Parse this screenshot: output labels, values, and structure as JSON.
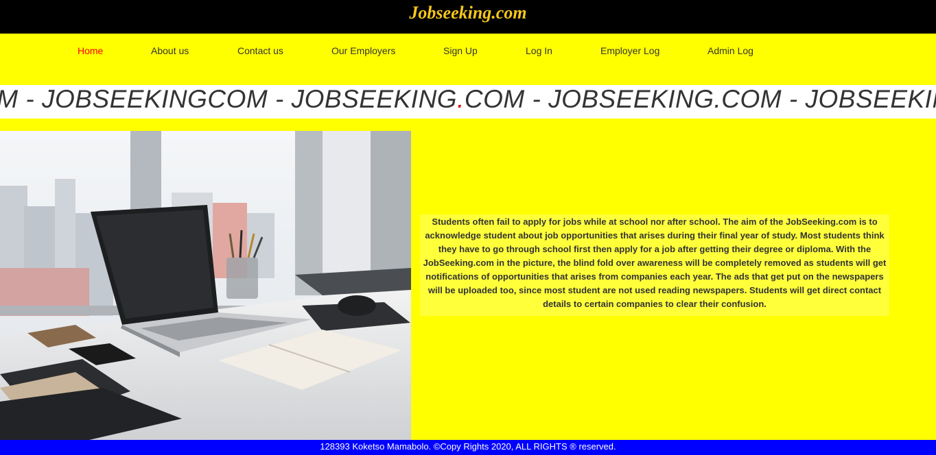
{
  "header": {
    "brand": "Jobseeking.com"
  },
  "nav": {
    "items": [
      {
        "label": "Home",
        "active": true
      },
      {
        "label": "About us"
      },
      {
        "label": "Contact us"
      },
      {
        "label": "Our Employers"
      },
      {
        "label": "Sign Up"
      },
      {
        "label": "Log In"
      },
      {
        "label": "Employer Log"
      },
      {
        "label": "Admin Log"
      }
    ]
  },
  "marquee": {
    "segments": [
      "OM - JOBSEEKINGCOM - JOBSEEKING",
      ".",
      "COM - JOBSEEKING.COM - JOBSEEKING",
      "."
    ]
  },
  "hero": {
    "image": "office-desk-laptop-photo"
  },
  "about": {
    "text": "Students often fail to apply for jobs while at school nor after school. The aim of the JobSeeking.com is to acknowledge student about job opportunities that arises during their final year of study. Most students think they have to go through school first then apply for a job after getting their degree or diploma. With the JobSeeking.com in the picture, the blind fold over awareness will be completely removed as students will get notifications of opportunities that arises from companies each year. The ads that get put on the newspapers will be uploaded too, since most student are not used reading newspapers. Students will get direct contact details to certain companies to clear their confusion."
  },
  "footer": {
    "text": "128393 Koketso Mamabolo. ©Copy Rights 2020, ALL RIGHTS ® reserved."
  },
  "colors": {
    "page_bg": "#ffff00",
    "topbar": "#000000",
    "brand": "#f5c61c",
    "active_nav": "#ff0000",
    "footer_bg": "#0000ff"
  }
}
